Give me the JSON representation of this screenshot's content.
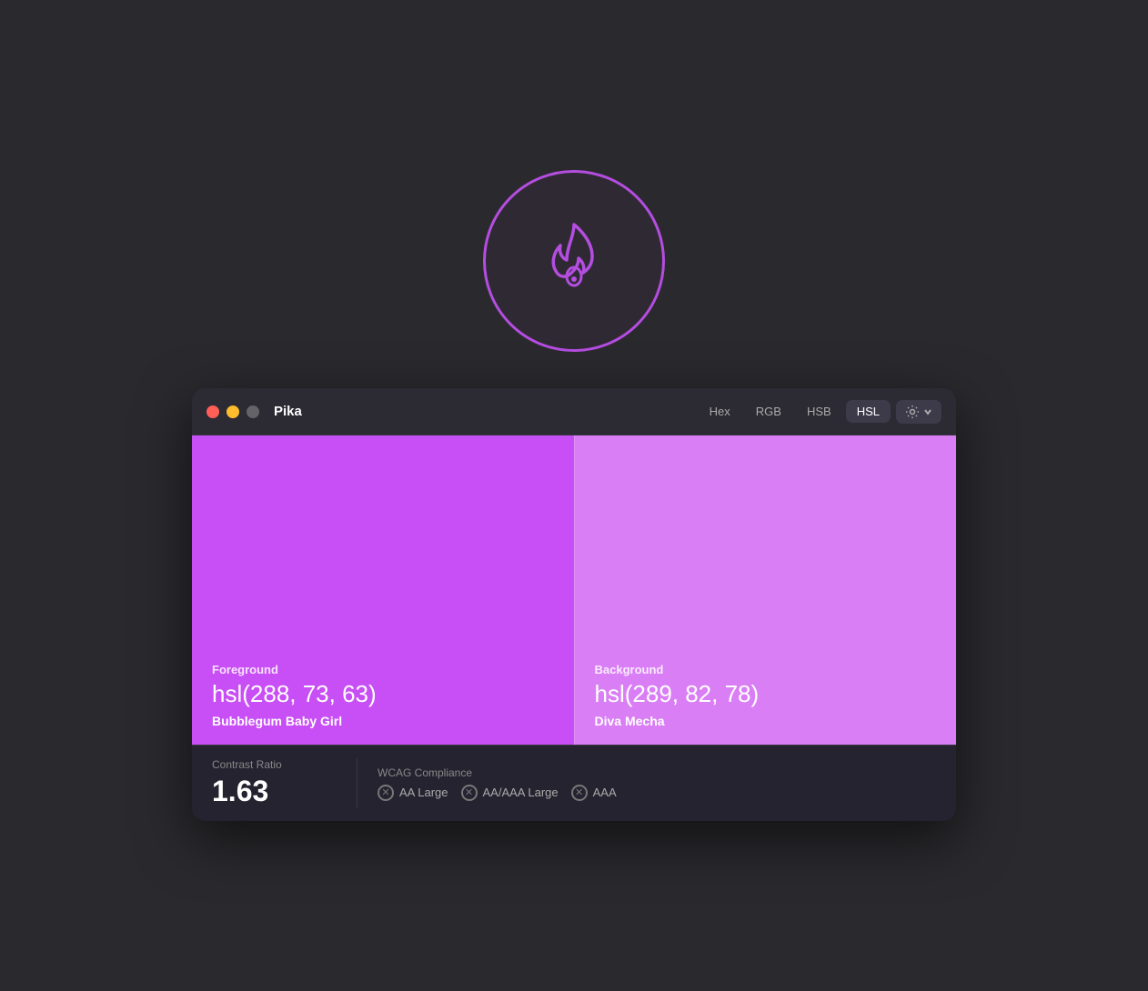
{
  "app": {
    "icon_label": "Pika app icon",
    "window_title": "Pika"
  },
  "titlebar": {
    "traffic_lights": [
      {
        "name": "close",
        "color": "#ff5f57"
      },
      {
        "name": "minimize",
        "color": "#ffbd2e"
      },
      {
        "name": "maximize",
        "color": "#636368"
      }
    ],
    "format_tabs": [
      {
        "label": "Hex",
        "active": false
      },
      {
        "label": "RGB",
        "active": false
      },
      {
        "label": "HSB",
        "active": false
      },
      {
        "label": "HSL",
        "active": true
      }
    ]
  },
  "foreground": {
    "label": "Foreground",
    "value": "hsl(288, 73, 63)",
    "name": "Bubblegum Baby Girl",
    "color": "#c84ef5"
  },
  "background": {
    "label": "Background",
    "value": "hsl(289, 82, 78)",
    "name": "Diva Mecha",
    "color": "#d97ef5"
  },
  "contrast": {
    "label": "Contrast Ratio",
    "value": "1.63"
  },
  "wcag": {
    "label": "WCAG Compliance",
    "badges": [
      {
        "label": "AA Large"
      },
      {
        "label": "AA/AAA Large"
      },
      {
        "label": "AAA"
      }
    ]
  }
}
